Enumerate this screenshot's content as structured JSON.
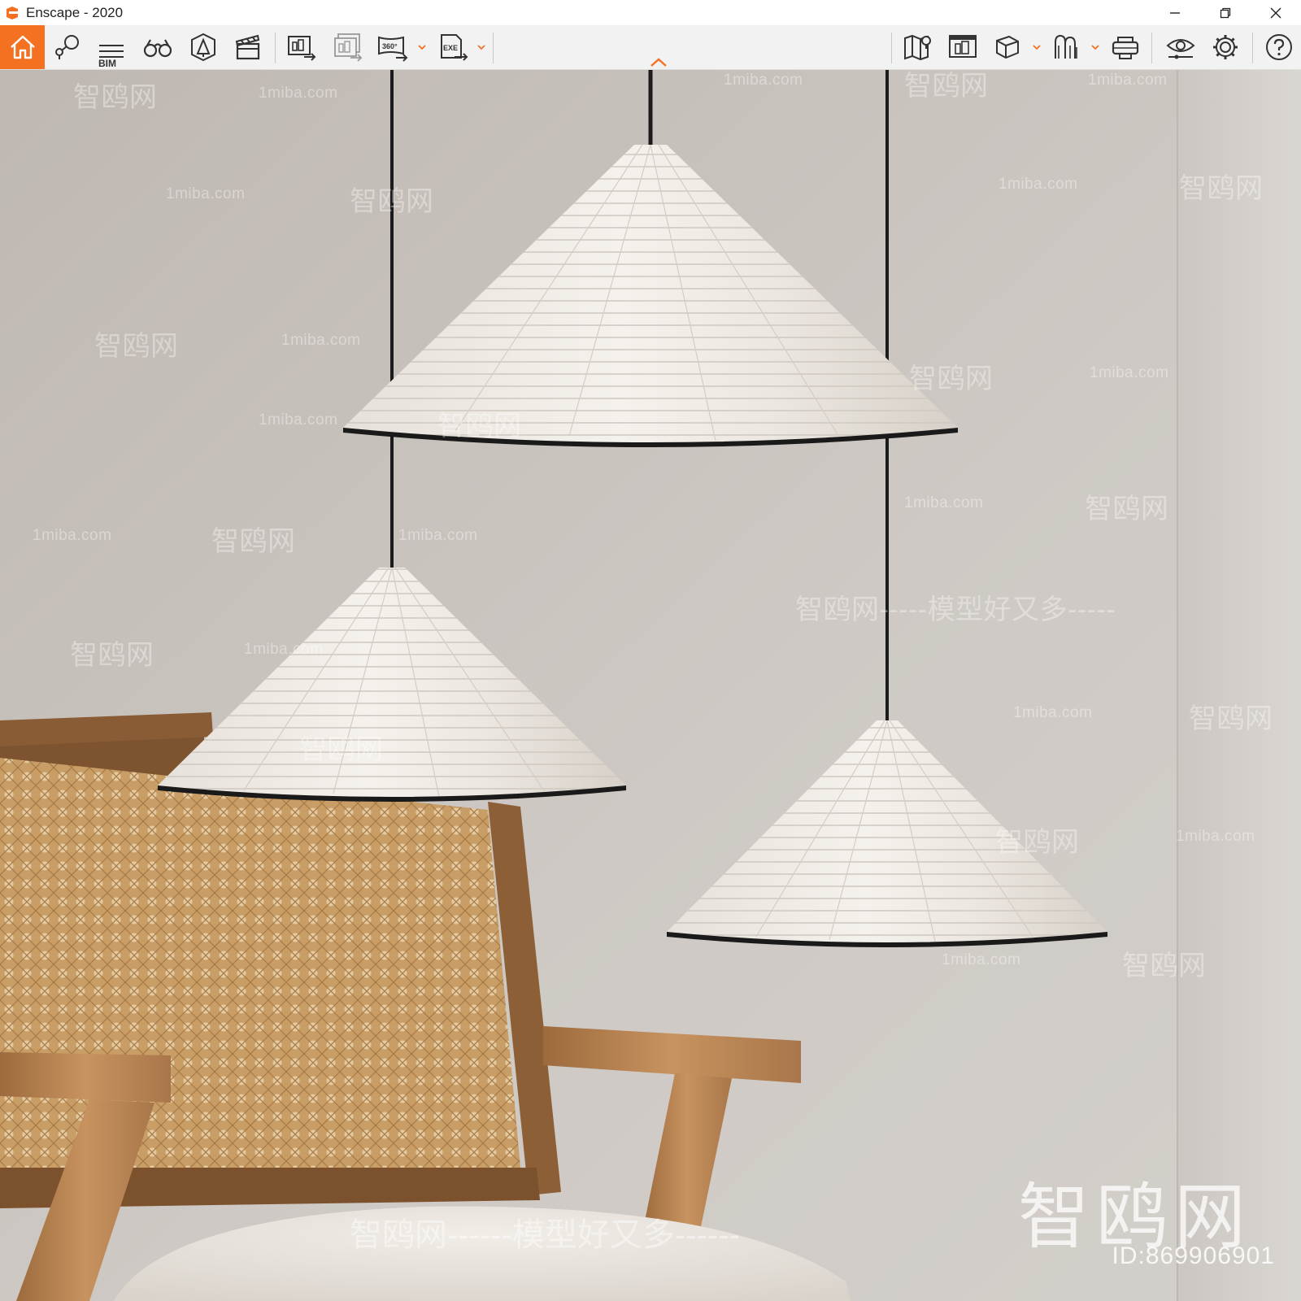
{
  "window": {
    "title": "Enscape - 2020",
    "controls": {
      "minimize_icon": "minimize-icon",
      "restore_icon": "restore-icon",
      "close_icon": "close-icon"
    }
  },
  "toolbar": {
    "accent": "#f37121",
    "bim_label": "BIM",
    "left_tools": [
      "home-icon",
      "views-icon",
      "bim-icon",
      "binoculars-icon",
      "asset-library-icon",
      "video-editor-icon",
      "render-image-icon",
      "batch-render-icon",
      "render-360-icon",
      "export-exe-icon"
    ],
    "right_tools": [
      "map-icon",
      "capture-manager-icon",
      "cube-view-icon",
      "atmosphere-icon",
      "vr-headset-icon",
      "visual-settings-icon",
      "settings-icon",
      "help-icon"
    ]
  },
  "watermarks": {
    "site": "1miba.com",
    "brand": "智鸥网",
    "slogan": "智鸥网-----模型好又多-----",
    "slogan_long": "智鸥网------模型好又多------",
    "dash": "------",
    "big_brand": "智鸥网",
    "id_label": "ID:869906901"
  },
  "scene": {
    "wall_color": "#c9c4bf",
    "lamp_color": "#efeae4",
    "wood_color": "#b27d4e",
    "cane_color": "#c9a06a"
  }
}
